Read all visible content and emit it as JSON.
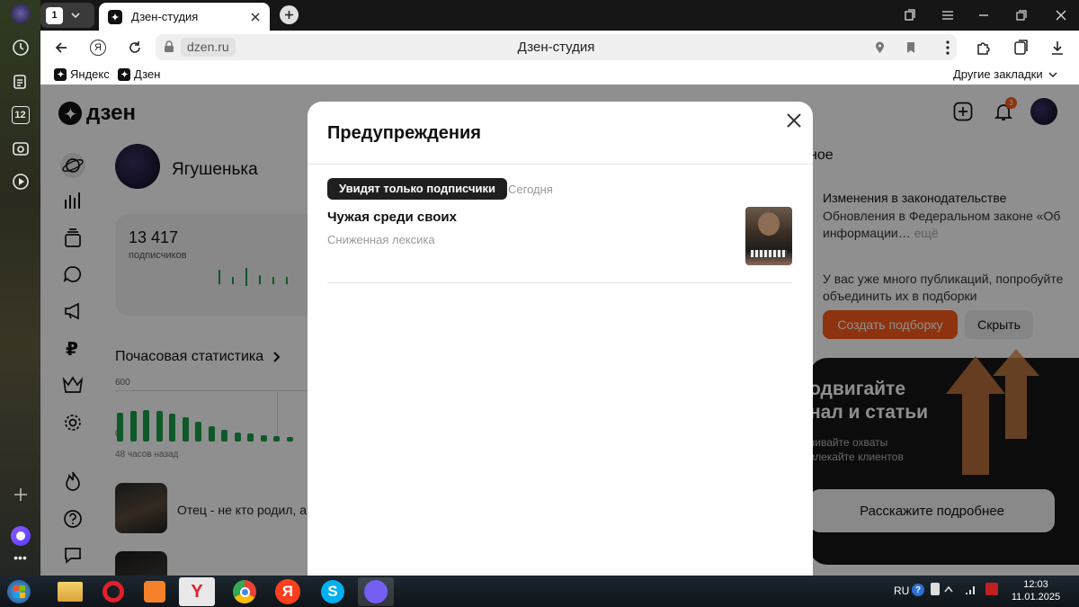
{
  "browser": {
    "tab_counter": "1",
    "active_tab_title": "Дзен-студия",
    "address_domain": "dzen.ru",
    "address_title": "Дзен-студия",
    "bookmarks": [
      "Яндекс",
      "Дзен"
    ],
    "other_bookmarks": "Другие закладки",
    "sidebar_badge": "12"
  },
  "dzen": {
    "logo": "дзен",
    "profile_name": "Ягушенька",
    "subscribers_count": "13 417",
    "subscribers_label": "подписчиков",
    "hourly_title": "Почасовая статистика",
    "hourly_ymax": "600",
    "hourly_ymin": "0",
    "hourly_xlabel": "48 часов назад",
    "hourly_values": [
      340,
      360,
      370,
      360,
      330,
      280,
      230,
      180,
      140,
      110,
      90,
      70,
      60,
      50
    ],
    "notif_badge": "3",
    "articles": [
      "Отец - не кто родил, а"
    ],
    "right_heading": "ное",
    "law_title": "Изменения в законодательстве",
    "law_text": "Обновления в Федеральном законе «Об информации…",
    "law_more": "ещё",
    "collection_text": "У вас уже много публикаций, попробуйте объединить их в подборки",
    "create_collection": "Создать подборку",
    "hide": "Скрыть",
    "promo_title": "одвигайте нал и статьи",
    "promo_sub": "чивайте охваты влекайте клиентов",
    "promo_button": "Расскажите подробнее"
  },
  "modal": {
    "title": "Предупреждения",
    "chip_label": "Увидят только подписчики",
    "date_label": "Сегодня",
    "item_title": "Чужая среди своих",
    "item_reason": "Сниженная лексика"
  },
  "taskbar": {
    "lang": "RU",
    "time": "12:03",
    "date": "11.01.2025"
  },
  "colors": {
    "accent_orange": "#fc5c1c",
    "dark_chip": "#1f1f1f",
    "bar_green": "#1a9e4a"
  }
}
